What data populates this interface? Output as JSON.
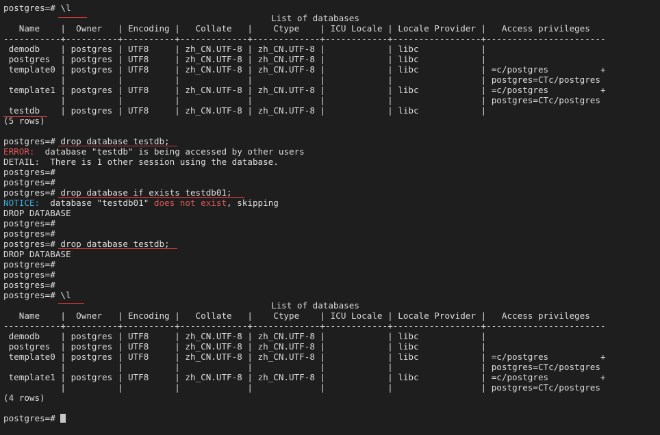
{
  "terminal": {
    "prompt": "postgres=# ",
    "table_title": "List of databases",
    "header": "   Name    |  Owner   | Encoding |   Collate   |    Ctype    | ICU Locale | Locale Provider |   Access privileges",
    "separator": "-----------+----------+----------+-------------+-------------+------------+-----------------+-----------------------",
    "rows_before": [
      " demodb    | postgres | UTF8     | zh_CN.UTF-8 | zh_CN.UTF-8 |            | libc            |",
      " postgres  | postgres | UTF8     | zh_CN.UTF-8 | zh_CN.UTF-8 |            | libc            |",
      " template0 | postgres | UTF8     | zh_CN.UTF-8 | zh_CN.UTF-8 |            | libc            | =c/postgres          +",
      "           |          |          |             |             |            |                 | postgres=CTc/postgres",
      " template1 | postgres | UTF8     | zh_CN.UTF-8 | zh_CN.UTF-8 |            | libc            | =c/postgres          +",
      "           |          |          |             |             |            |                 | postgres=CTc/postgres",
      " testdb    | postgres | UTF8     | zh_CN.UTF-8 | zh_CN.UTF-8 |            | libc            |"
    ],
    "count_before": "(5 rows)",
    "rows_after": [
      " demodb    | postgres | UTF8     | zh_CN.UTF-8 | zh_CN.UTF-8 |            | libc            |",
      " postgres  | postgres | UTF8     | zh_CN.UTF-8 | zh_CN.UTF-8 |            | libc            |",
      " template0 | postgres | UTF8     | zh_CN.UTF-8 | zh_CN.UTF-8 |            | libc            | =c/postgres          +",
      "           |          |          |             |             |            |                 | postgres=CTc/postgres",
      " template1 | postgres | UTF8     | zh_CN.UTF-8 | zh_CN.UTF-8 |            | libc            | =c/postgres          +",
      "           |          |          |             |             |            |                 | postgres=CTc/postgres"
    ],
    "count_after": "(4 rows)",
    "cmd_list": "\\l",
    "cmd_drop_testdb": "drop database testdb;",
    "cmd_drop_if_exists": "drop database if exists testdb01;",
    "error_label": "ERROR:",
    "error_text": "  database \"testdb\" is being accessed by other users",
    "detail_text": "DETAIL:  There is 1 other session using the database.",
    "notice_label": "NOTICE:",
    "notice_text_a": "  database \"testdb01\" ",
    "notice_text_b": "does not exist",
    "notice_text_c": ", skipping",
    "drop_result": "DROP DATABASE",
    "colors": {
      "background": "#1e1e1e",
      "text": "#dcdcdc",
      "error": "#e05555",
      "notice": "#3fa9d8",
      "underline": "#d23a3a"
    }
  }
}
